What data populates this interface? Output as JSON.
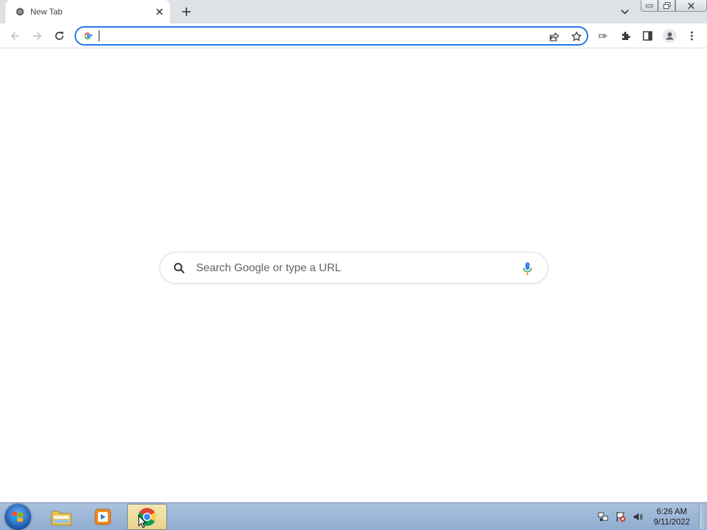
{
  "browser": {
    "tab": {
      "title": "New Tab",
      "favicon": "chrome-favicon-icon",
      "close_icon": "close-icon"
    },
    "new_tab_icon": "plus-icon",
    "tab_search_icon": "chevron-down-icon",
    "window_controls": [
      "minimize-icon",
      "restore-icon",
      "close-icon"
    ],
    "toolbar": {
      "back_icon": "arrow-left-icon",
      "forward_icon": "arrow-right-icon",
      "reload_icon": "reload-icon",
      "omnibox": {
        "value": "",
        "provider_icon": "google-g-icon",
        "share_icon": "share-icon",
        "bookmark_icon": "star-icon"
      },
      "extensions": [
        "extension-icon",
        "puzzle-icon",
        "side-panel-icon",
        "profile-icon",
        "kebab-menu-icon"
      ]
    },
    "accent_color": "#1a73e8"
  },
  "ntp": {
    "search": {
      "placeholder": "Search Google or type a URL",
      "search_icon": "magnifier-icon",
      "voice_icon": "microphone-icon"
    }
  },
  "taskbar": {
    "start_icon": "windows-start-icon",
    "pinned": [
      "file-explorer-icon",
      "media-player-icon",
      "chrome-icon"
    ],
    "active": "chrome-icon",
    "tray": [
      "network-icon",
      "action-center-flag-icon",
      "volume-icon"
    ],
    "clock": {
      "time": "6:26 AM",
      "date": "9/11/2022"
    }
  }
}
